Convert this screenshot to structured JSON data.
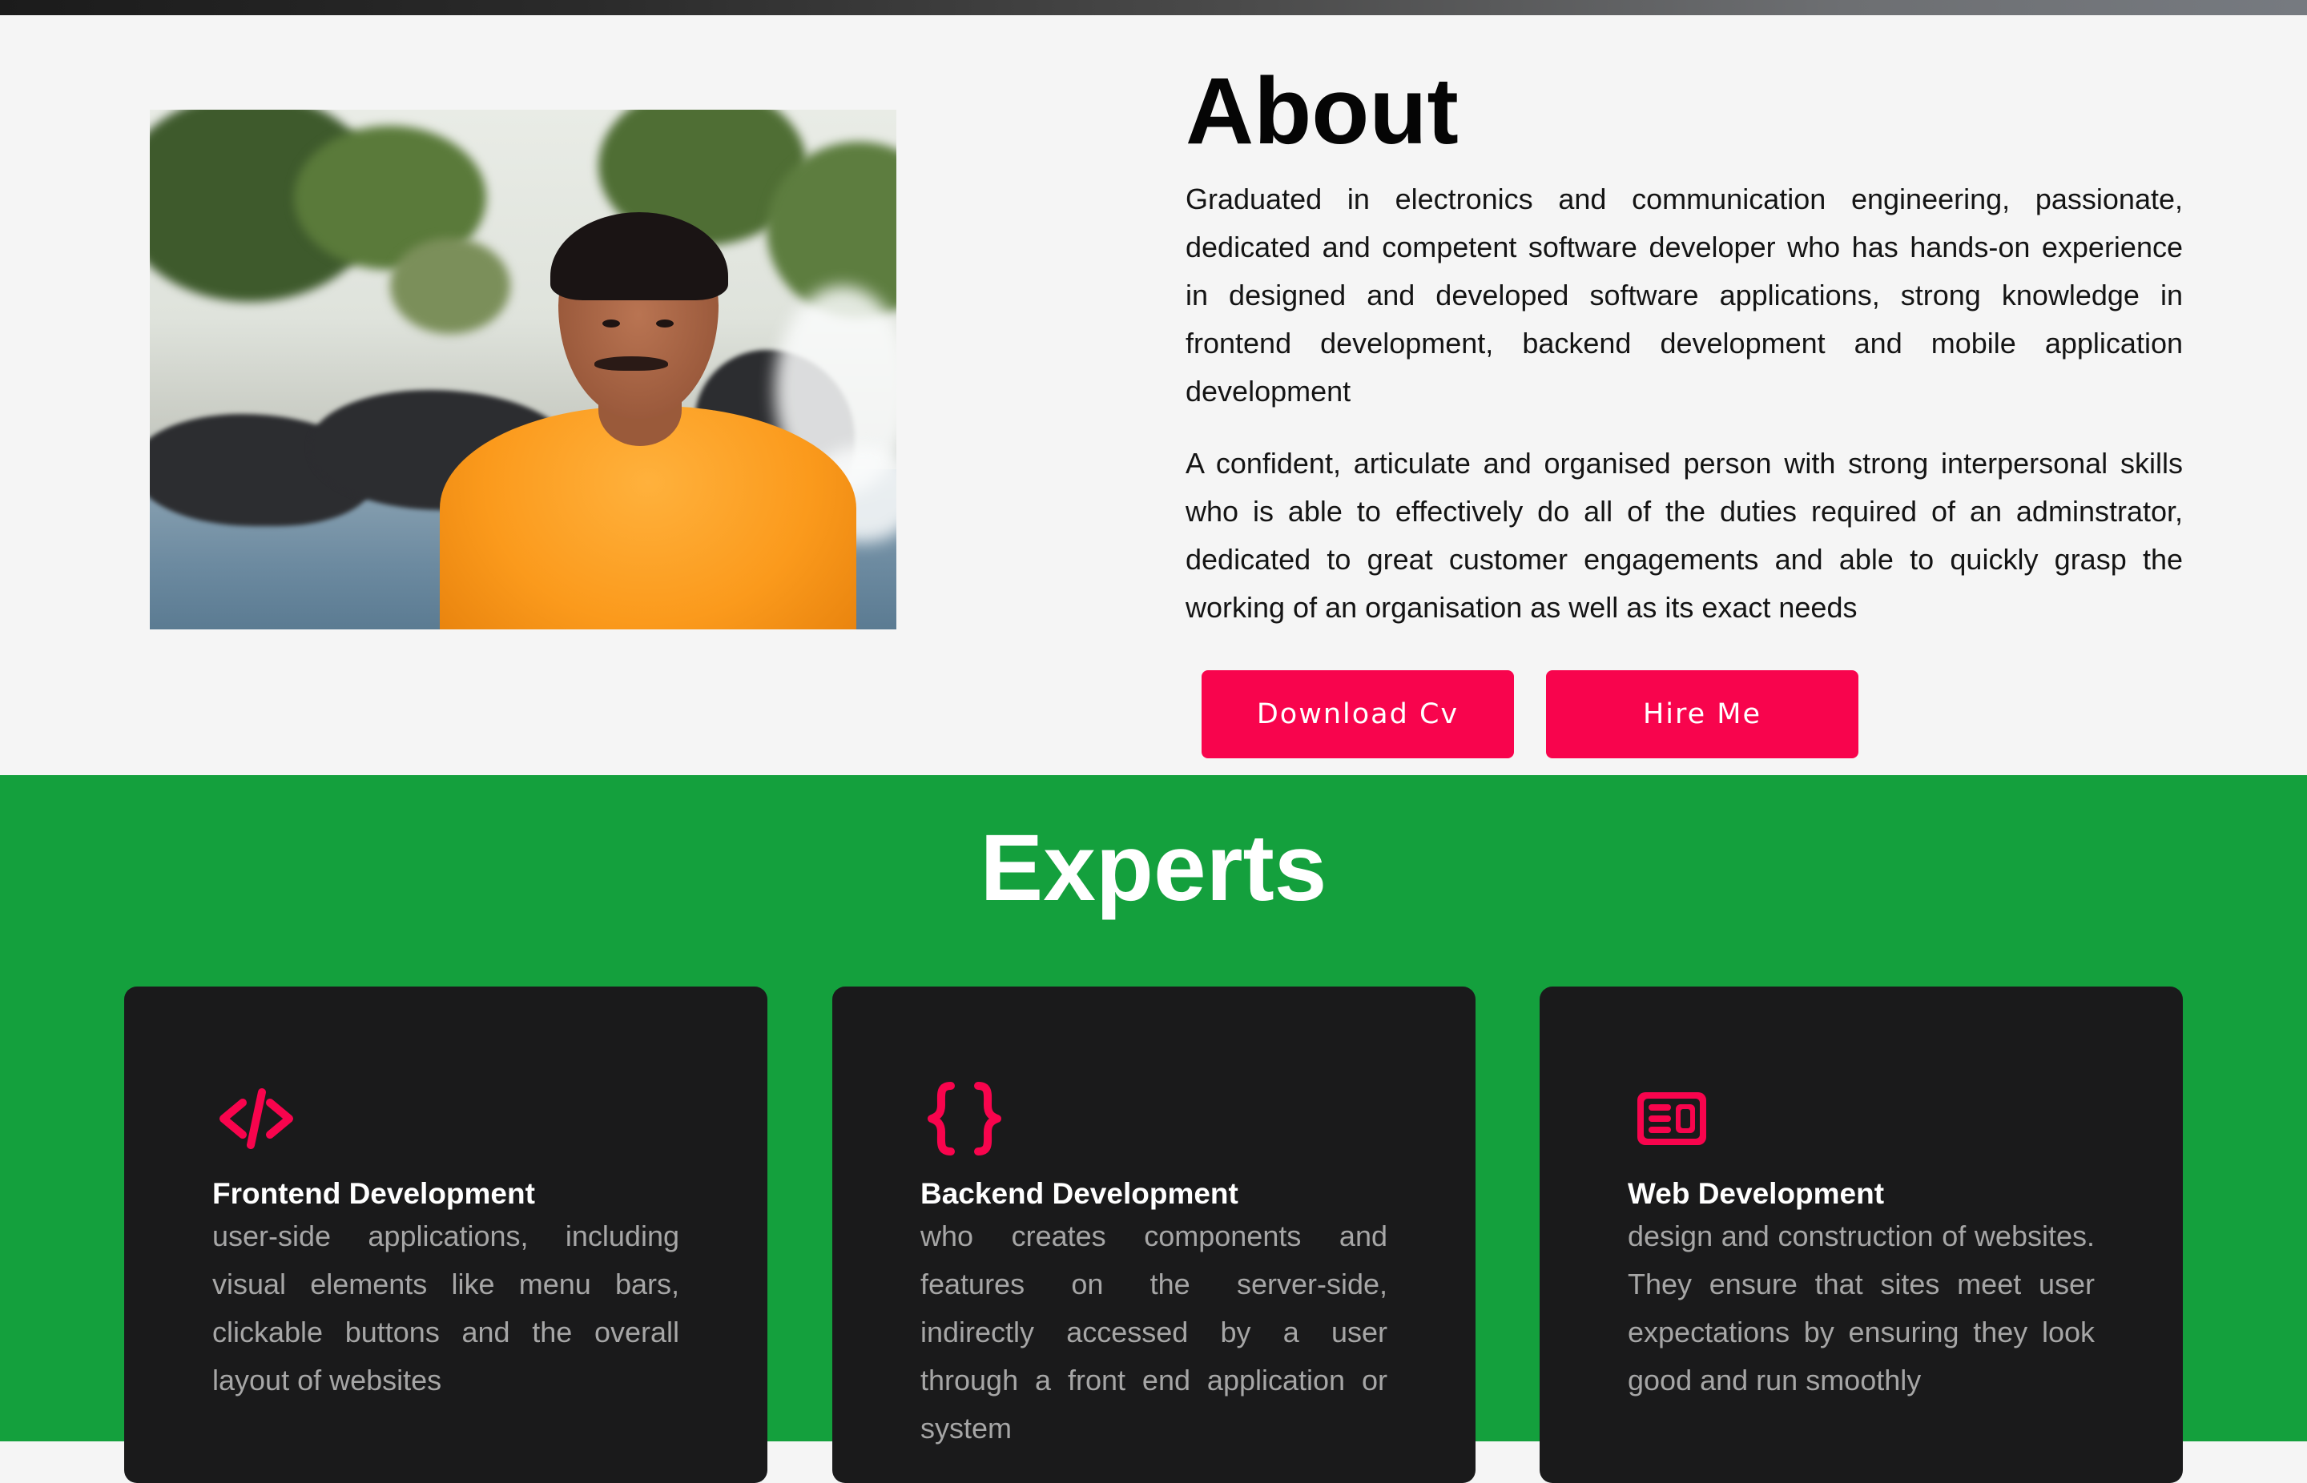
{
  "about": {
    "title": "About",
    "paragraph1": "Graduated in electronics and communication engineering, passionate, dedicated and competent software developer who has hands-on experience in designed and developed software applications, strong knowledge in frontend development, backend development and mobile application development",
    "paragraph2": "A confident, articulate and organised person with strong interpersonal skills who is able to effectively do all of the duties required of an adminstrator, dedicated to great customer engagements and able to quickly grasp the working of an organisation as well as its exact needs",
    "download_label": "Download Cv",
    "hire_label": "Hire Me"
  },
  "experts": {
    "title": "Experts",
    "cards": [
      {
        "icon": "code-icon",
        "title": "Frontend Development",
        "text": "user-side applications, including visual elements like menu bars, clickable buttons and the overall layout of websites"
      },
      {
        "icon": "braces-icon",
        "title": "Backend Development",
        "text": "who creates components and features on the server-side, indirectly accessed by a user through a front end application or system"
      },
      {
        "icon": "web-layout-icon",
        "title": "Web Development",
        "text": "design and construction of websites. They ensure that sites meet user expectations by ensuring they look good and run smoothly"
      }
    ]
  },
  "colors": {
    "accent": "#f8044d",
    "experts_bg": "#14a03d",
    "card_bg": "#1a1a1b",
    "page_bg": "#f5f5f5"
  }
}
